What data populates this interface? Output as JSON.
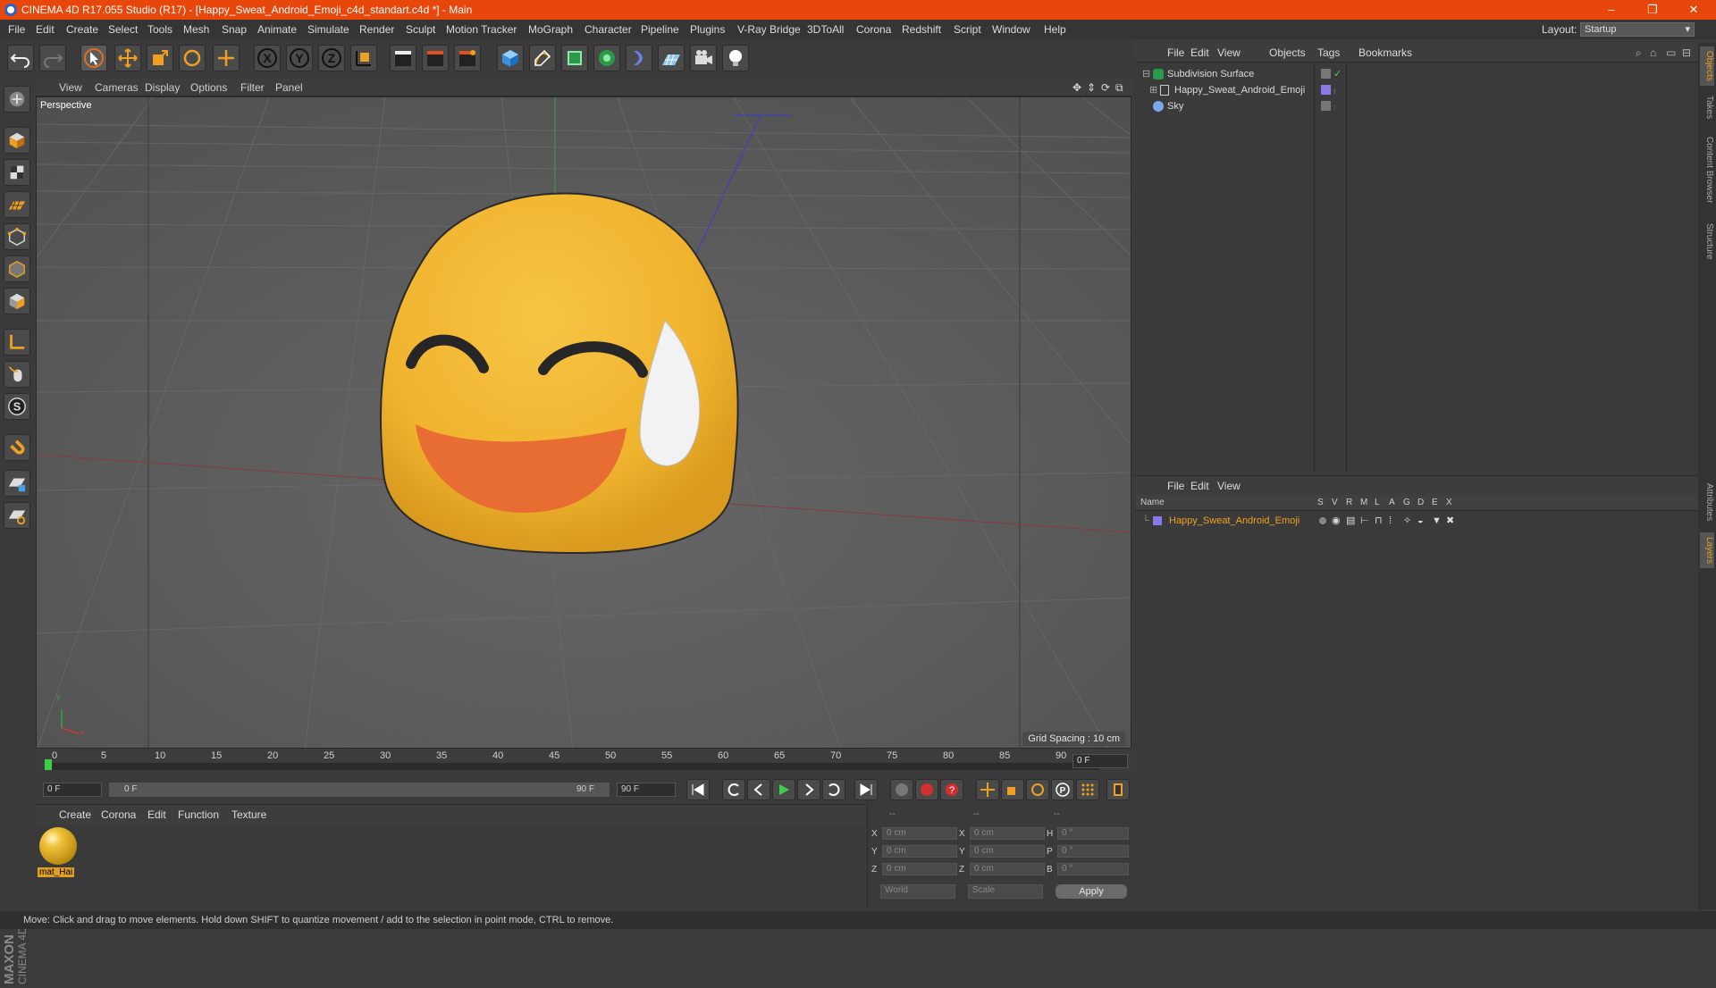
{
  "window": {
    "title": "CINEMA 4D R17.055 Studio (R17) - [Happy_Sweat_Android_Emoji_c4d_standart.c4d *] - Main",
    "minimize": "–",
    "maximize": "❐",
    "close": "✕"
  },
  "menubar": {
    "items": [
      "File",
      "Edit",
      "Create",
      "Select",
      "Tools",
      "Mesh",
      "Snap",
      "Animate",
      "Simulate",
      "Render",
      "Sculpt",
      "Motion Tracker",
      "MoGraph",
      "Character",
      "Pipeline",
      "Plugins",
      "V-Ray Bridge",
      "3DToAll",
      "Corona",
      "Redshift",
      "Script",
      "Window",
      "Help"
    ],
    "layout_label": "Layout:",
    "layout_value": "Startup"
  },
  "viewport": {
    "menu": [
      "View",
      "Cameras",
      "Display",
      "Options",
      "Filter",
      "Panel"
    ],
    "label": "Perspective",
    "grid_spacing": "Grid Spacing : 10 cm",
    "axis_x": "x",
    "axis_y": "y"
  },
  "timeline": {
    "ticks": [
      "0",
      "5",
      "10",
      "15",
      "20",
      "25",
      "30",
      "35",
      "40",
      "45",
      "50",
      "55",
      "60",
      "65",
      "70",
      "75",
      "80",
      "85",
      "90"
    ],
    "current_frame": "0 F",
    "start_field": "0 F",
    "range_start": "0 F",
    "range_end": "90 F",
    "end_field": "90 F"
  },
  "material_manager": {
    "menu": [
      "Create",
      "Corona",
      "Edit",
      "Function",
      "Texture"
    ],
    "material_name": "mat_Hai"
  },
  "coordinates": {
    "headers": [
      "--",
      "--",
      "--"
    ],
    "rows": [
      {
        "axis": "X",
        "pos": "0 cm",
        "axis2": "X",
        "size": "0 cm",
        "rot_label": "H",
        "rot": "0 °"
      },
      {
        "axis": "Y",
        "pos": "0 cm",
        "axis2": "Y",
        "size": "0 cm",
        "rot_label": "P",
        "rot": "0 °"
      },
      {
        "axis": "Z",
        "pos": "0 cm",
        "axis2": "Z",
        "size": "0 cm",
        "rot_label": "B",
        "rot": "0 °"
      }
    ],
    "mode": "World",
    "size_mode": "Scale",
    "apply": "Apply"
  },
  "object_manager": {
    "menu": [
      "File",
      "Edit",
      "View",
      "Objects",
      "Tags",
      "Bookmarks"
    ],
    "objects": [
      "Subdivision Surface",
      "Happy_Sweat_Android_Emoji",
      "Sky"
    ]
  },
  "layer_manager": {
    "menu": [
      "File",
      "Edit",
      "View"
    ],
    "columns": [
      "Name",
      "S",
      "V",
      "R",
      "M",
      "L",
      "A",
      "G",
      "D",
      "E",
      "X"
    ],
    "layers": [
      "Happy_Sweat_Android_Emoji"
    ]
  },
  "side_tabs": [
    "Objects",
    "Takes",
    "Content Browser",
    "Structure",
    "Attributes",
    "Layers"
  ],
  "status": "Move: Click and drag to move elements. Hold down SHIFT to quantize movement / add to the selection in point mode, CTRL to remove.",
  "brand": [
    "MAXON",
    "CINEMA 4D"
  ],
  "colors": {
    "titlebar": "#e8470b",
    "emoji_face": "#f2b630",
    "emoji_mouth": "#e86d33",
    "layer_name": "#f0a020"
  }
}
